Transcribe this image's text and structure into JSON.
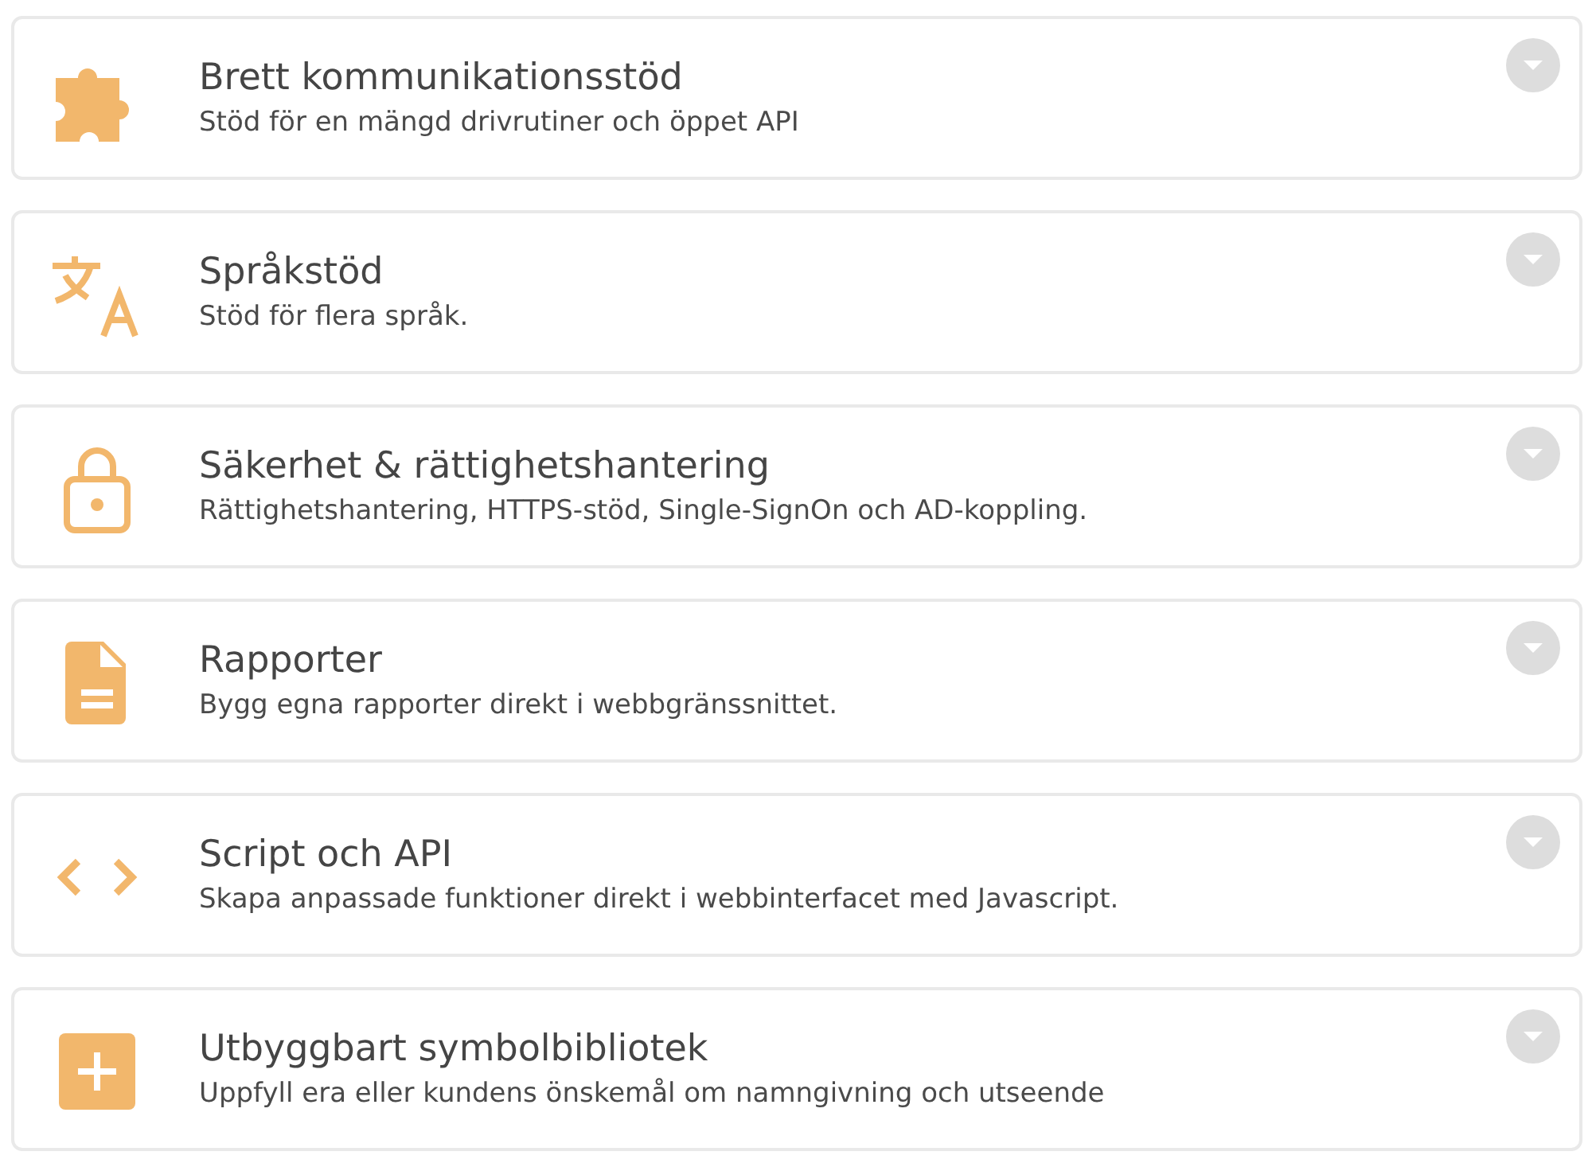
{
  "features": [
    {
      "kind": "puzzle",
      "title": "Brett kommunikationsstöd",
      "description": "Stöd för en mängd drivrutiner och öppet API",
      "expanded": false
    },
    {
      "kind": "translate",
      "title": "Språkstöd",
      "description": "Stöd för flera språk.",
      "expanded": false
    },
    {
      "kind": "lock",
      "title": "Säkerhet & rättighetshantering",
      "description": "Rättighetshantering, HTTPS-stöd, Single-SignOn och AD-koppling.",
      "expanded": false
    },
    {
      "kind": "document",
      "title": "Rapporter",
      "description": "Bygg egna rapporter direkt i webbgränssnittet.",
      "expanded": false
    },
    {
      "kind": "code",
      "title": "Script och API",
      "description": "Skapa anpassade funktioner direkt i webbinterfacet med Javascript.",
      "expanded": false
    },
    {
      "kind": "plus",
      "title": "Utbyggbart symbolbibliotek",
      "description": "Uppfyll era eller kundens önskemål om namngivning och utseende",
      "expanded": false
    }
  ]
}
